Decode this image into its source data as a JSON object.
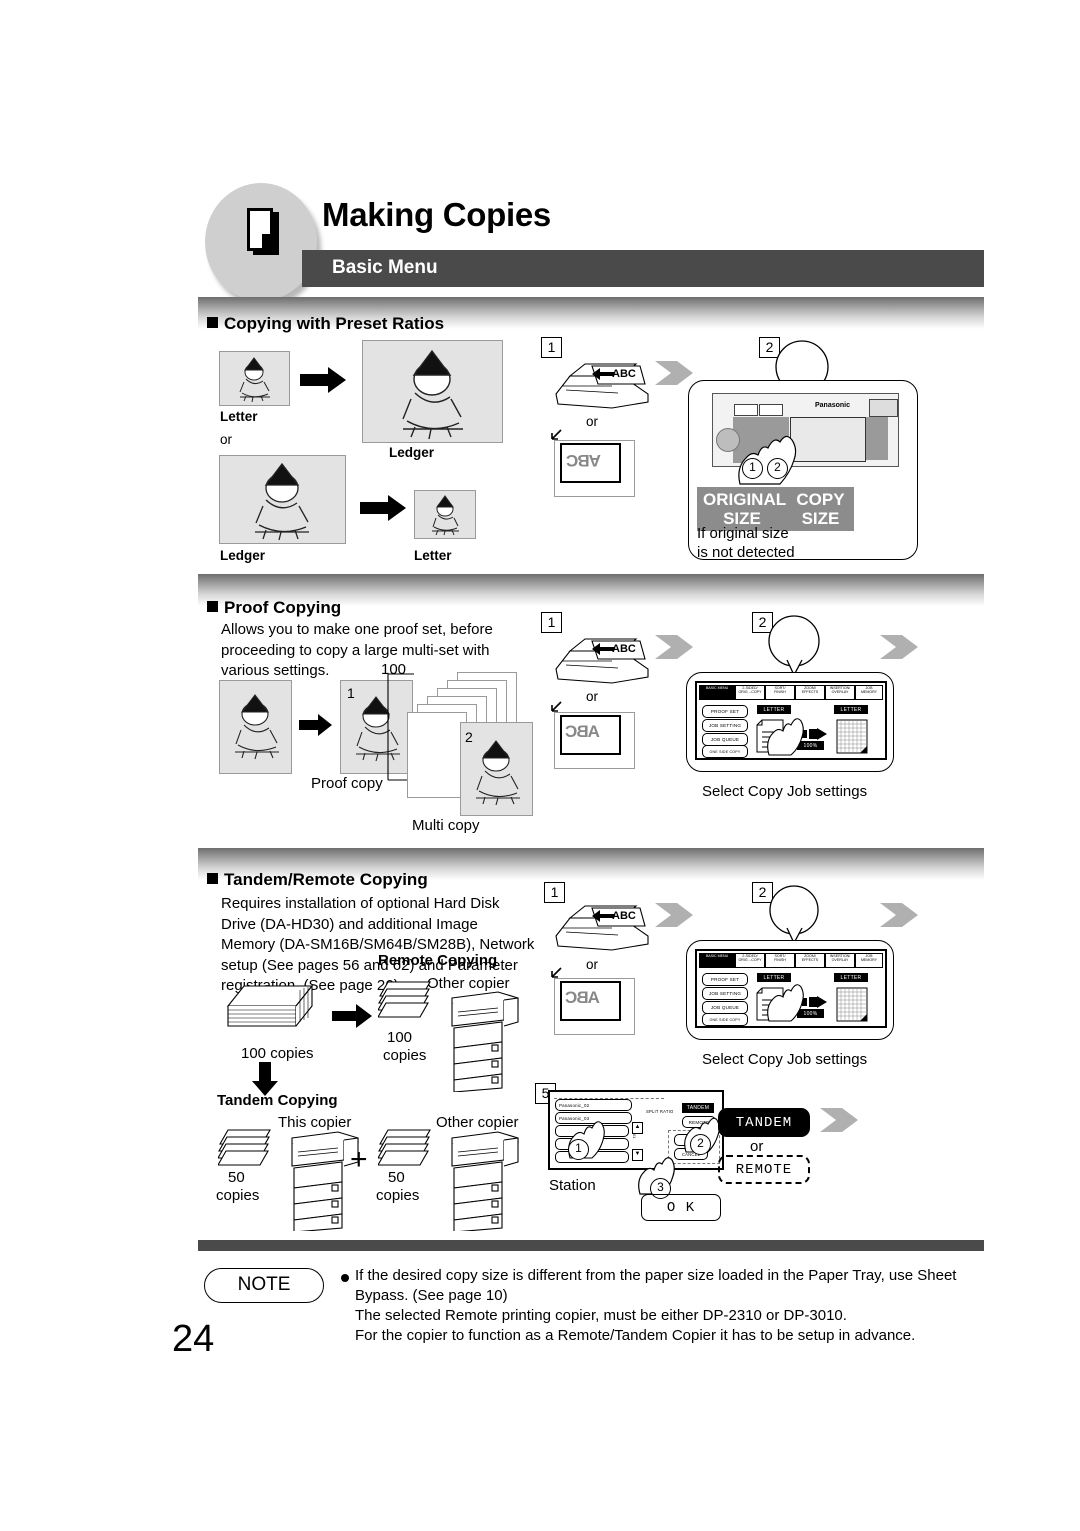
{
  "header": {
    "title": "Making Copies",
    "subtitle": "Basic Menu",
    "icon": "document-page-icon"
  },
  "sections": [
    {
      "id": "preset-ratios",
      "title": "Copying with Preset Ratios",
      "diagram": {
        "row1": {
          "from": "Letter",
          "to": "Ledger"
        },
        "or": "or",
        "row2": {
          "from": "Ledger",
          "to": "Letter"
        }
      },
      "steps": [
        {
          "num": "1",
          "or_label": "or",
          "platen_text": "ABC",
          "feeder_text": "ABC"
        },
        {
          "num": "2",
          "chips": [
            "ORIGINAL\nSIZE",
            "COPY\nSIZE"
          ],
          "chip1_line1": "ORIGINAL",
          "chip1_line2": "SIZE",
          "chip2_line1": "COPY",
          "chip2_line2": "SIZE",
          "caption_line1": "If original size",
          "caption_line2": "is not detected",
          "panel_brand": "Panasonic",
          "hand_marks": [
            "1",
            "2"
          ]
        }
      ]
    },
    {
      "id": "proof-copying",
      "title": "Proof Copying",
      "body": "Allows you to make one proof set, before proceeding to copy a large multi-set with various settings.",
      "labels": {
        "proof_copy": "Proof copy",
        "multi_copy": "Multi copy",
        "count": "100",
        "sheet1": "1",
        "sheet2": "2"
      },
      "steps": [
        {
          "num": "1",
          "or_label": "or",
          "platen_text": "ABC"
        },
        {
          "num": "2",
          "caption": "Select Copy Job settings"
        }
      ]
    },
    {
      "id": "tandem-remote",
      "title": "Tandem/Remote Copying",
      "body": "Requires installation of optional Hard Disk Drive (DA-HD30) and additional Image Memory (DA-SM16B/SM64B/SM28B), Network setup (See pages 56 and 62) and Parameter registration. (See page 26)",
      "remote": {
        "heading": "Remote Copying",
        "source_label": "100 copies",
        "dest_label_line1": "100",
        "dest_label_line2": "copies",
        "other_copier": "Other copier"
      },
      "tandem": {
        "heading": "Tandem Copying",
        "this_copier": "This copier",
        "other_copier": "Other copier",
        "left_count_line1": "50",
        "left_count_line2": "copies",
        "right_count_line1": "50",
        "right_count_line2": "copies",
        "plus": "+"
      },
      "steps": [
        {
          "num": "1",
          "or_label": "or",
          "platen_text": "ABC"
        },
        {
          "num": "2",
          "caption": "Select Copy Job settings"
        },
        {
          "num": "5",
          "station_label": "Station",
          "ok_label": "O K",
          "tandem_btn": "TANDEM",
          "or_label": "or",
          "remote_btn": "REMOTE",
          "split_ratio": "SPLIT RATIO",
          "list_items": [
            "Panasonic_02",
            "Panasonic_03"
          ],
          "marks": [
            "1",
            "2",
            "3"
          ]
        }
      ]
    }
  ],
  "lcd": {
    "tabs": [
      {
        "l1": "BASIC MENU",
        "l2": "",
        "active": true
      },
      {
        "l1": "2-SIDED/",
        "l2": "ORIG→COPY",
        "active": false
      },
      {
        "l1": "SORT/",
        "l2": "FINISH",
        "active": false
      },
      {
        "l1": "ZOOM/",
        "l2": "EFFECTS",
        "active": false
      },
      {
        "l1": "INSERTION/",
        "l2": "OVERLAY",
        "active": false
      },
      {
        "l1": "JOB",
        "l2": "MEMORY",
        "active": false
      }
    ],
    "buttons": [
      "PROOF SET",
      "JOB SETTING",
      "JOB QUEUE",
      "ONE SIDE COPY"
    ],
    "orig_chip": "LETTER",
    "copy_chip": "LETTER",
    "zoom_chip": "100%"
  },
  "note": {
    "label": "NOTE",
    "lines": [
      "If the desired copy size is different from the paper size loaded in the Paper Tray, use Sheet",
      "Bypass. (See page 10)",
      "The selected Remote printing copier, must be either DP-2310 or DP-3010.",
      "For the copier to function as a Remote/Tandem Copier it has to be setup in advance."
    ]
  },
  "page_number": "24",
  "colors": {
    "bar_dark": "#4a4a4a",
    "chip_gray": "#8c8c8c",
    "image_fill": "#e3e3e3",
    "chevron_gray": "#b0b0b0"
  }
}
